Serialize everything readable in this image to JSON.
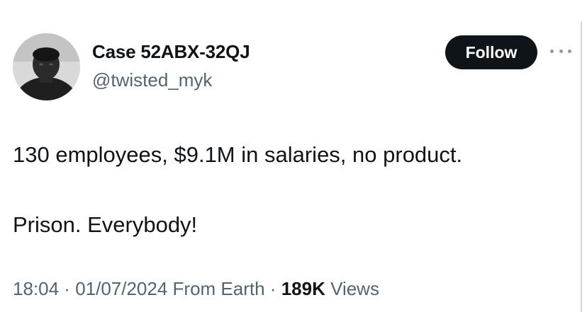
{
  "user": {
    "display_name": "Case 52ABX-32QJ",
    "handle": "@twisted_myk"
  },
  "follow_label": "Follow",
  "more_icon": "more-horizontal-icon",
  "tweet": {
    "line1": "130 employees, $9.1M in salaries, no product.",
    "line2": "Prison. Everybody!"
  },
  "meta": {
    "time": "18:04",
    "sep1": " · ",
    "date": "01/07/2024",
    "location": " From Earth",
    "sep2": " · ",
    "views_count": "189K",
    "views_label": " Views"
  },
  "colors": {
    "text": "#0f1419",
    "secondary": "#536471",
    "follow_bg": "#0f1419"
  }
}
